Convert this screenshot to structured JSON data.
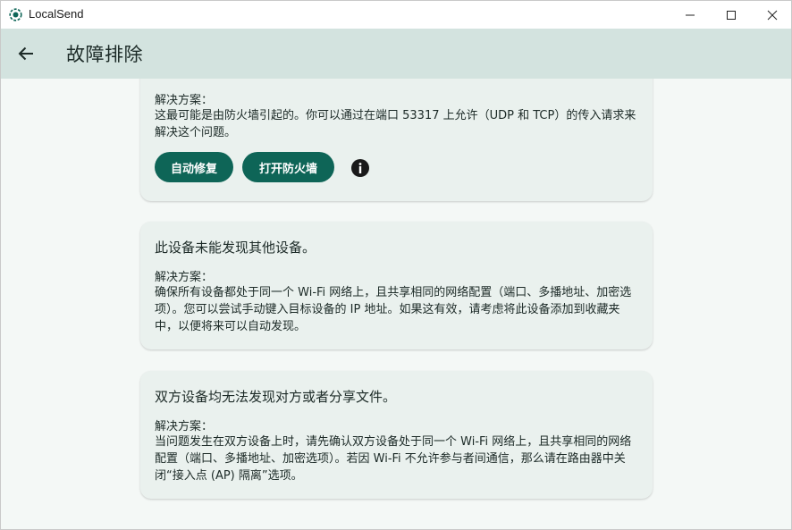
{
  "window": {
    "title": "LocalSend",
    "icons": {
      "logo": "localsend-logo",
      "minimize": "minimize-icon",
      "maximize": "maximize-icon",
      "close": "close-icon"
    }
  },
  "appbar": {
    "back_icon": "arrow-left-icon",
    "title": "故障排除"
  },
  "colors": {
    "appbar_bg": "#d3e3df",
    "card_bg": "#eaf1ee",
    "accent_button": "#0e6557",
    "page_bg": "#f4f8f6"
  },
  "cards": [
    {
      "solution_label": "解决方案：",
      "solution_text": "这最可能是由防火墙引起的。你可以通过在端口 53317 上允许（UDP 和 TCP）的传入请求来解决这个问题。",
      "actions": [
        "自动修复",
        "打开防火墙"
      ],
      "info_icon": "info-icon"
    },
    {
      "title": "此设备未能发现其他设备。",
      "solution_label": "解决方案：",
      "solution_text": "确保所有设备都处于同一个 Wi-Fi 网络上，且共享相同的网络配置（端口、多播地址、加密选项）。您可以尝试手动键入目标设备的 IP 地址。如果这有效，请考虑将此设备添加到收藏夹中，以便将来可以自动发现。"
    },
    {
      "title": "双方设备均无法发现对方或者分享文件。",
      "solution_label": "解决方案：",
      "solution_text": "当问题发生在双方设备上时，请先确认双方设备处于同一个 Wi-Fi 网络上，且共享相同的网络配置（端口、多播地址、加密选项）。若因 Wi-Fi 不允许参与者间通信，那么请在路由器中关闭“接入点 (AP) 隔离”选项。"
    }
  ]
}
